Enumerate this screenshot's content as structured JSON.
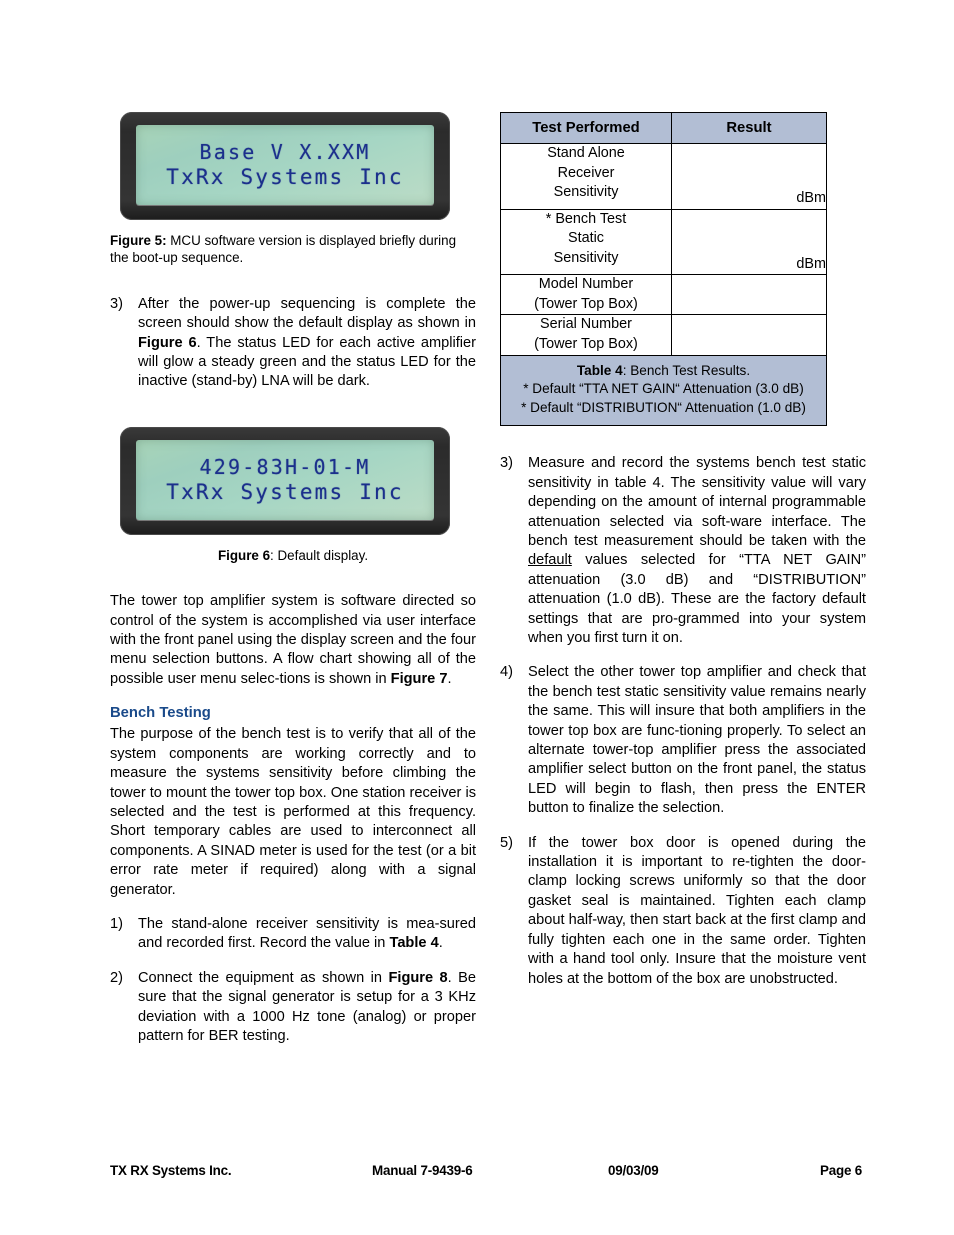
{
  "figure5": {
    "lcd_line1": "Base V X.XXM",
    "lcd_line2": "TxRx Systems Inc",
    "caption_label": "Figure 5:",
    "caption_text": " MCU software version is displayed briefly during the boot-up sequence."
  },
  "figure6": {
    "lcd_line1": "429-83H-01-M",
    "lcd_line2": "TxRx Systems Inc",
    "caption_label": "Figure 6",
    "caption_text": ": Default display."
  },
  "left_column": {
    "item3_num": "3)",
    "item3_part1": "After the power-up sequencing is complete the screen should show the default display as shown in ",
    "item3_bold": "Figure 6",
    "item3_part2": ". The status LED for each active amplifier will glow a steady green and the status LED for the inactive (stand-by) LNA will be dark.",
    "para_software_part1": "The tower top amplifier system is software directed so control of the system is accomplished via user interface with the front panel using the display screen and the four menu selection buttons. A flow chart showing all of the possible user menu selec-tions is shown in ",
    "para_software_bold": "Figure 7",
    "para_software_part2": ".",
    "bench_heading": "Bench Testing",
    "bench_para": "The purpose of the bench test is to verify that all of the system components are working correctly and to measure the systems sensitivity before climbing the tower to mount the tower top box. One station receiver is selected and the test is performed at this frequency. Short temporary cables are used to interconnect all components. A SINAD meter is used for the test (or a bit error rate meter if required) along with a signal generator.",
    "item1_num": "1)",
    "item1_part1": "The stand-alone receiver sensitivity is mea-sured and recorded first. Record the value in ",
    "item1_bold": "Table 4",
    "item1_part2": ".",
    "item2_num": "2)",
    "item2_part1": "Connect the equipment as shown in ",
    "item2_bold": "Figure 8",
    "item2_part2": ". Be sure that the signal generator is setup for a 3 KHz deviation with a 1000 Hz tone (analog) or proper pattern for BER testing."
  },
  "table4": {
    "headers": [
      "Test Performed",
      "Result"
    ],
    "rows": [
      {
        "test": "Stand Alone\nReceiver\nSensitivity",
        "result": "dBm"
      },
      {
        "test": "* Bench Test\nStatic\nSensitivity",
        "result": "dBm"
      },
      {
        "test": "Model Number\n(Tower Top Box)",
        "result": ""
      },
      {
        "test": "Serial Number\n(Tower Top Box)",
        "result": ""
      }
    ],
    "caption_label": "Table 4",
    "caption_text": ": Bench Test Results.",
    "caption_note1": "* Default “TTA NET GAIN“ Attenuation (3.0 dB)",
    "caption_note2": "* Default “DISTRIBUTION“ Attenuation (1.0 dB)",
    "header_fill": "#b2bed4"
  },
  "right_column": {
    "item3_num": "3)",
    "item3_part1": "Measure and record the systems bench test static sensitivity in table 4. The sensitivity value will vary depending on the amount of internal programmable attenuation selected via soft-ware interface. The bench test measurement should be taken with the ",
    "item3_underlined": "default",
    "item3_part2": " values selected for “TTA NET GAIN” attenuation (3.0 dB) and “DISTRIBUTION” attenuation (1.0 dB). These are the factory default settings that are pro-grammed into your system when you first turn it on.",
    "item4_num": "4)",
    "item4_text": "Select the other tower top amplifier and check that the bench test static sensitivity value remains nearly the same. This will insure that both amplifiers in the tower top box are func-tioning properly. To select an alternate tower-top amplifier press the associated amplifier select button on the front panel, the status LED will begin to flash, then press the ENTER button to finalize the selection.",
    "item5_num": "5)",
    "item5_text": "If the tower box door is opened during the installation it is important to re-tighten the door-clamp locking screws uniformly so that the door gasket seal is maintained. Tighten each clamp about half-way, then start back at the first clamp and fully tighten each one in the same order. Tighten with a hand tool only. Insure that the moisture vent holes at the bottom of the box are unobstructed."
  },
  "footer": {
    "company": "TX RX Systems Inc.",
    "manual": "Manual 7-9439-6",
    "date": "09/03/09",
    "page": "Page 6"
  },
  "colors": {
    "heading_blue": "#1a4a8a",
    "table_header_fill": "#b2bed4",
    "lcd_text": "#1b2f8c"
  }
}
